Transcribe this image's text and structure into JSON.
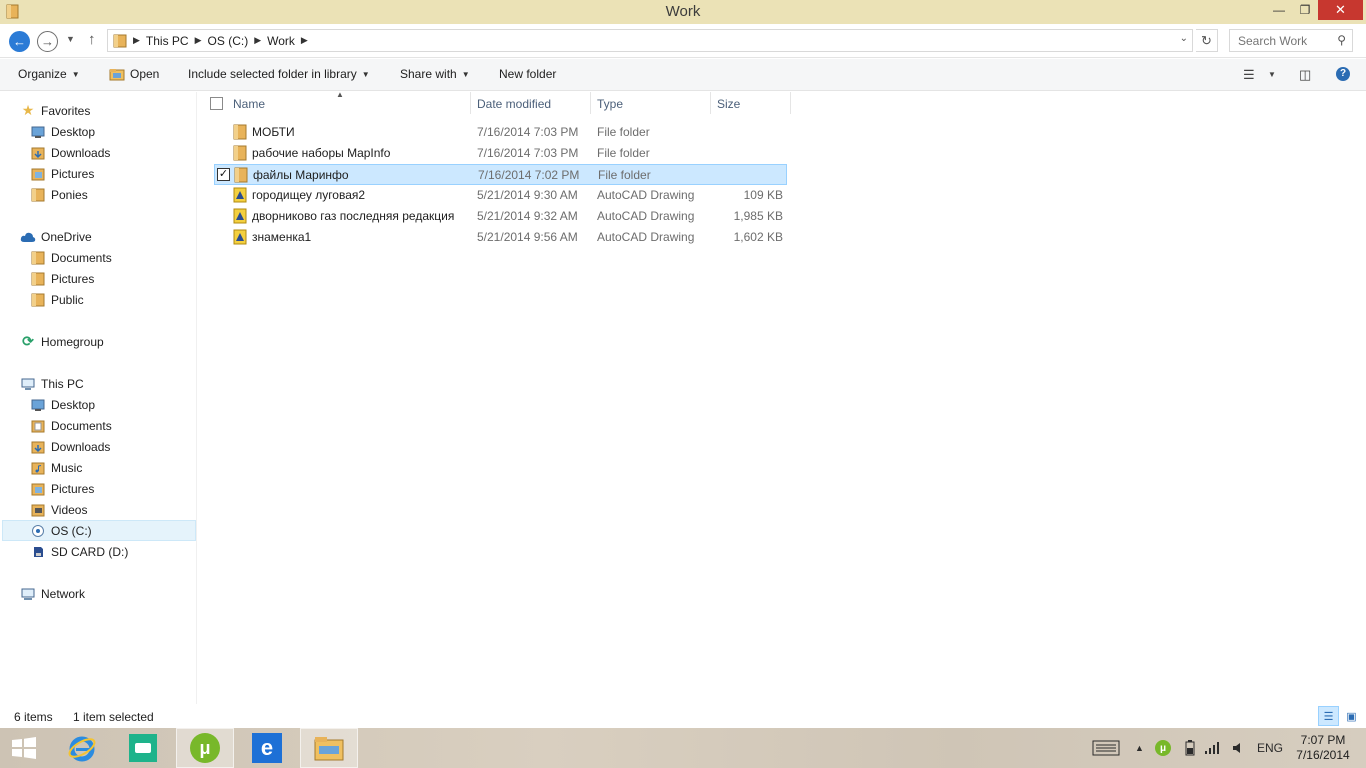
{
  "window": {
    "title": "Work"
  },
  "address": {
    "breadcrumbs": [
      "This PC",
      "OS (C:)",
      "Work"
    ],
    "search_placeholder": "Search Work"
  },
  "toolbar": {
    "organize": "Organize",
    "open": "Open",
    "include_library": "Include selected folder in library",
    "share_with": "Share with",
    "new_folder": "New folder"
  },
  "navpane": {
    "favorites": {
      "label": "Favorites",
      "items": [
        "Desktop",
        "Downloads",
        "Pictures",
        "Ponies"
      ]
    },
    "onedrive": {
      "label": "OneDrive",
      "items": [
        "Documents",
        "Pictures",
        "Public"
      ]
    },
    "homegroup": {
      "label": "Homegroup"
    },
    "thispc": {
      "label": "This PC",
      "items": [
        "Desktop",
        "Documents",
        "Downloads",
        "Music",
        "Pictures",
        "Videos",
        "OS (C:)",
        "SD CARD (D:)"
      ]
    },
    "network": {
      "label": "Network"
    },
    "selected": "OS (C:)"
  },
  "filelist": {
    "columns": [
      "Name",
      "Date modified",
      "Type",
      "Size"
    ],
    "rows": [
      {
        "name": "МОБТИ",
        "date": "7/16/2014 7:03 PM",
        "type": "File folder",
        "size": "",
        "icon": "folder-icon",
        "selected": false
      },
      {
        "name": "рабочие наборы MapInfo",
        "date": "7/16/2014 7:03 PM",
        "type": "File folder",
        "size": "",
        "icon": "folder-icon",
        "selected": false
      },
      {
        "name": "файлы Маринфо",
        "date": "7/16/2014 7:02 PM",
        "type": "File folder",
        "size": "",
        "icon": "folder-icon",
        "selected": true
      },
      {
        "name": "городищеу луговая2",
        "date": "5/21/2014 9:30 AM",
        "type": "AutoCAD Drawing",
        "size": "109 KB",
        "icon": "autocad-drawing-icon",
        "selected": false
      },
      {
        "name": "дворниково газ последняя редакция",
        "date": "5/21/2014 9:32 AM",
        "type": "AutoCAD Drawing",
        "size": "1,985 KB",
        "icon": "autocad-drawing-icon",
        "selected": false
      },
      {
        "name": "знаменка1",
        "date": "5/21/2014 9:56 AM",
        "type": "AutoCAD Drawing",
        "size": "1,602 KB",
        "icon": "autocad-drawing-icon",
        "selected": false
      }
    ]
  },
  "status": {
    "item_count": "6 items",
    "selected_count": "1 item selected"
  },
  "taskbar": {
    "apps": [
      "internet-explorer-icon",
      "evernote-icon",
      "utorrent-icon",
      "ie-metro-icon",
      "file-explorer-icon"
    ],
    "language": "ENG",
    "time": "7:07 PM",
    "date": "7/16/2014"
  }
}
